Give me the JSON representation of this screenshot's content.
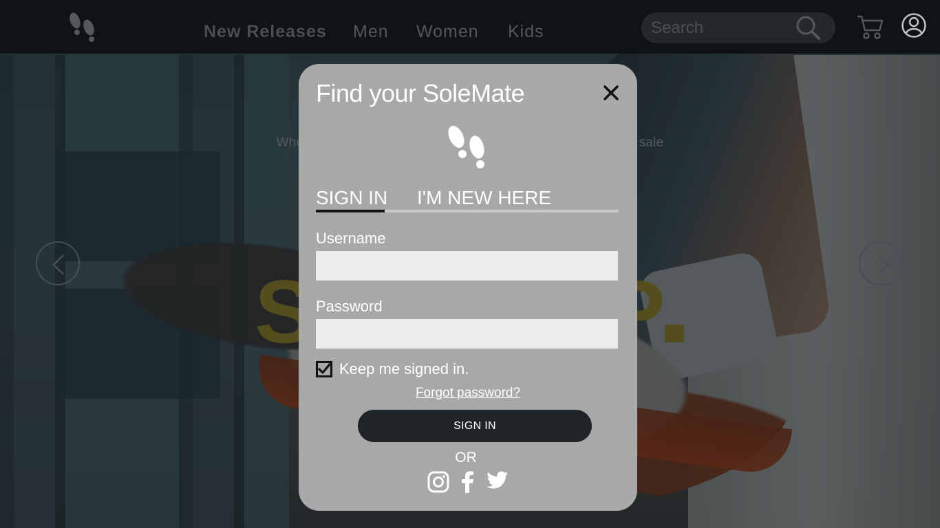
{
  "nav": {
    "links": [
      "New Releases",
      "Men",
      "Women",
      "Kids"
    ],
    "search_placeholder": "Search"
  },
  "hero": {
    "tagline": "Where y                                                                         w on sale",
    "letter_left": "S",
    "letter_right": "P"
  },
  "modal": {
    "title": "Find your SoleMate",
    "tabs": [
      "SIGN IN",
      "I'M NEW HERE"
    ],
    "active_tab": "SIGN IN",
    "username_label": "Username",
    "username_value": "",
    "password_label": "Password",
    "password_value": "",
    "keep_signed_in_label": "Keep me signed in.",
    "keep_signed_in_checked": true,
    "forgot_password": "Forgot password?",
    "submit_label": "SIGN IN",
    "or_label": "OR",
    "social": [
      "instagram-icon",
      "facebook-icon",
      "twitter-icon"
    ]
  },
  "colors": {
    "modal_bg": "#a8a8a8",
    "button_bg": "#1e2427",
    "nav_bg": "#111417",
    "accent_yellow": "#6b6320"
  }
}
